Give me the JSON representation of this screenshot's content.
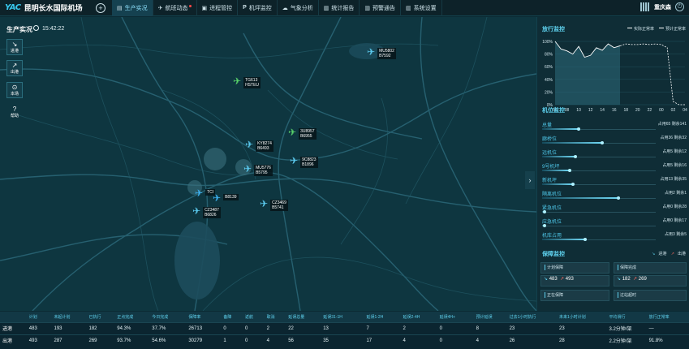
{
  "app": {
    "logo_mark": "YAC",
    "airport_name": "昆明长水国际机场",
    "add_icon": "plus-circle-icon"
  },
  "nav": [
    {
      "label": "生产实况",
      "icon": "chart-icon",
      "active": true,
      "alert": false
    },
    {
      "label": "航班动态",
      "icon": "plane-icon",
      "active": false,
      "alert": true
    },
    {
      "label": "进程管控",
      "icon": "process-icon",
      "active": false,
      "alert": false
    },
    {
      "label": "机坪监控",
      "icon": "parking-icon",
      "active": false,
      "alert": false
    },
    {
      "label": "气象分析",
      "icon": "cloud-icon",
      "active": false,
      "alert": false
    },
    {
      "label": "统计报告",
      "icon": "bar-chart-icon",
      "active": false,
      "alert": false
    },
    {
      "label": "预警通告",
      "icon": "bar-chart-icon",
      "active": false,
      "alert": false
    },
    {
      "label": "系统设置",
      "icon": "settings-icon",
      "active": false,
      "alert": false
    }
  ],
  "user": {
    "name": "重庆森"
  },
  "map": {
    "title": "生产实况",
    "time": "15:42:22",
    "side_buttons": [
      {
        "label": "进港",
        "icon": "arrow-in-icon"
      },
      {
        "label": "出港",
        "icon": "arrow-out-icon"
      },
      {
        "label": "本场",
        "icon": "location-pin-icon"
      },
      {
        "label": "帮助",
        "icon": "help-icon"
      }
    ],
    "flights": [
      {
        "flight": "TG613",
        "reg": "HSTEU",
        "color": "green"
      },
      {
        "flight": "MU5802",
        "reg": "B7592",
        "color": "cyan"
      },
      {
        "flight": "3U8957",
        "reg": "B6955",
        "color": "green"
      },
      {
        "flight": "KY8274",
        "reg": "B6493",
        "color": "cyan"
      },
      {
        "flight": "9C8823",
        "reg": "B1896",
        "color": "cyan"
      },
      {
        "flight": "MU5776",
        "reg": "B5795",
        "color": "cyan"
      },
      {
        "flight": "TCI",
        "reg": "",
        "color": "blue"
      },
      {
        "flight": "",
        "reg": "B8139",
        "color": "blue"
      },
      {
        "flight": "CZ3469",
        "reg": "B5741",
        "color": "cyan"
      },
      {
        "flight": "CZ3487",
        "reg": "B6826",
        "color": "cyan"
      }
    ]
  },
  "punctuality": {
    "title": "放行监控",
    "legend_actual": "实际正常率",
    "legend_forecast": "预计正常率",
    "chart_data": {
      "type": "line",
      "title": "",
      "x": [
        "06",
        "07",
        "08",
        "09",
        "10",
        "11",
        "12",
        "13",
        "14",
        "15",
        "16",
        "17",
        "18",
        "19",
        "20",
        "21",
        "22",
        "23",
        "00",
        "01",
        "02",
        "03",
        "04"
      ],
      "x_tick_labels": [
        "06",
        "08",
        "10",
        "12",
        "14",
        "16",
        "18",
        "20",
        "22",
        "00",
        "02",
        "04"
      ],
      "y_tick_labels": [
        "100%",
        "80%",
        "60%",
        "40%",
        "20%",
        "0%"
      ],
      "ylim": [
        0,
        100
      ],
      "series": [
        {
          "name": "实际正常率",
          "style": "solid",
          "values": [
            100,
            88,
            85,
            80,
            92,
            75,
            78,
            90,
            86,
            96,
            90,
            93,
            null,
            null,
            null,
            null,
            null,
            null,
            null,
            null,
            null,
            null,
            null
          ]
        },
        {
          "name": "预计正常率",
          "style": "dashed",
          "values": [
            null,
            null,
            null,
            null,
            null,
            null,
            null,
            null,
            null,
            null,
            null,
            93,
            96,
            95,
            95,
            96,
            95,
            96,
            95,
            90,
            5,
            0,
            0
          ]
        }
      ]
    }
  },
  "stand_monitor": {
    "title": "机位监控",
    "rows": [
      {
        "name": "总量",
        "value": "占用65 剩余141",
        "fraction": 0.32
      },
      {
        "name": "廊桥位",
        "value": "占用36 剩余32",
        "fraction": 0.53
      },
      {
        "name": "远机位",
        "value": "占用5 剩余12",
        "fraction": 0.29
      },
      {
        "name": "9号机坪",
        "value": "占用5 剩余16",
        "fraction": 0.24
      },
      {
        "name": "新机坪",
        "value": "占用13 剩余35",
        "fraction": 0.27
      },
      {
        "name": "隔离机位",
        "value": "占用2 剩余1",
        "fraction": 0.67
      },
      {
        "name": "紧急机位",
        "value": "占用0 剩余28",
        "fraction": 0.02
      },
      {
        "name": "应急机位",
        "value": "占用0 剩余17",
        "fraction": 0.02
      },
      {
        "name": "机库占用",
        "value": "占用3 剩余5",
        "fraction": 0.38
      }
    ]
  },
  "guarantee": {
    "title": "保障监控",
    "legend_in": "进港",
    "legend_out": "出港",
    "boxes": [
      {
        "title": "计划保障",
        "in": "483",
        "out": "493"
      },
      {
        "title": "保障完成",
        "in": "182",
        "out": "269"
      },
      {
        "title": "正在保障",
        "in": "",
        "out": ""
      },
      {
        "title": "过站超时",
        "in": "",
        "out": ""
      }
    ]
  },
  "stats_table": {
    "headers": [
      "",
      "计划",
      "未起计划",
      "已执行",
      "正点完成",
      "今日完成",
      "保障率",
      "备降",
      "返航",
      "取消",
      "延误总量",
      "延误31-1H",
      "延误1-2H",
      "延误2-4H",
      "延误4H+",
      "预计延误",
      "过去1小时执行",
      "未来1小时计划",
      "平均滑行",
      "放行正常率"
    ],
    "rows": [
      [
        "进港",
        "483",
        "193",
        "182",
        "94.3%",
        "37.7%",
        "26713",
        "0",
        "0",
        "2",
        "22",
        "13",
        "7",
        "2",
        "0",
        "8",
        "23",
        "23",
        "3.2分钟/架",
        "—"
      ],
      [
        "出港",
        "493",
        "287",
        "269",
        "93.7%",
        "54.6%",
        "30279",
        "1",
        "0",
        "4",
        "56",
        "35",
        "17",
        "4",
        "0",
        "4",
        "26",
        "28",
        "2.2分钟/架",
        "91.8%"
      ]
    ]
  }
}
